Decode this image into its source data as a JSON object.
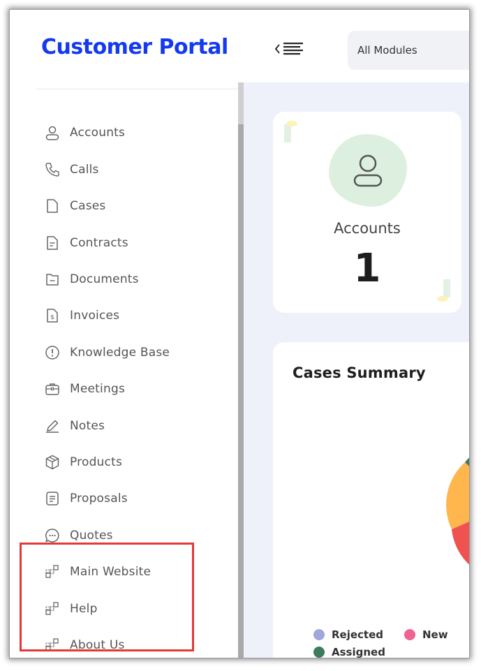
{
  "header": {
    "brand": "Customer Portal",
    "module_select": "All Modules"
  },
  "sidebar": {
    "items": [
      {
        "label": "Accounts",
        "icon": "user-icon"
      },
      {
        "label": "Calls",
        "icon": "phone-icon"
      },
      {
        "label": "Cases",
        "icon": "file-icon"
      },
      {
        "label": "Contracts",
        "icon": "document-text-icon"
      },
      {
        "label": "Documents",
        "icon": "document-minus-icon"
      },
      {
        "label": "Invoices",
        "icon": "invoice-icon"
      },
      {
        "label": "Knowledge Base",
        "icon": "info-circle-icon"
      },
      {
        "label": "Meetings",
        "icon": "briefcase-icon"
      },
      {
        "label": "Notes",
        "icon": "pencil-icon"
      },
      {
        "label": "Products",
        "icon": "box-icon"
      },
      {
        "label": "Proposals",
        "icon": "list-document-icon"
      },
      {
        "label": "Quotes",
        "icon": "chat-bubble-icon"
      }
    ],
    "links": [
      {
        "label": "Main Website",
        "icon": "external-link-icon"
      },
      {
        "label": "Help",
        "icon": "external-link-icon"
      },
      {
        "label": "About Us",
        "icon": "external-link-icon"
      }
    ]
  },
  "accounts_card": {
    "label": "Accounts",
    "count": "1",
    "icon": "user-icon"
  },
  "summary": {
    "title": "Cases Summary"
  },
  "chart_data": {
    "type": "pie",
    "title": "Cases Summary",
    "legend": [
      {
        "name": "Rejected",
        "color": "#9fa8da"
      },
      {
        "name": "New",
        "color": "#f06292"
      },
      {
        "name": "Assigned",
        "color": "#3d7a5e"
      }
    ],
    "visible_segment_colors": [
      "#3d7a5e",
      "#ffb74d",
      "#ef5350"
    ]
  },
  "colors": {
    "brand": "#1439f2",
    "highlight": "#e53935",
    "main_background": "#eef1fa"
  }
}
